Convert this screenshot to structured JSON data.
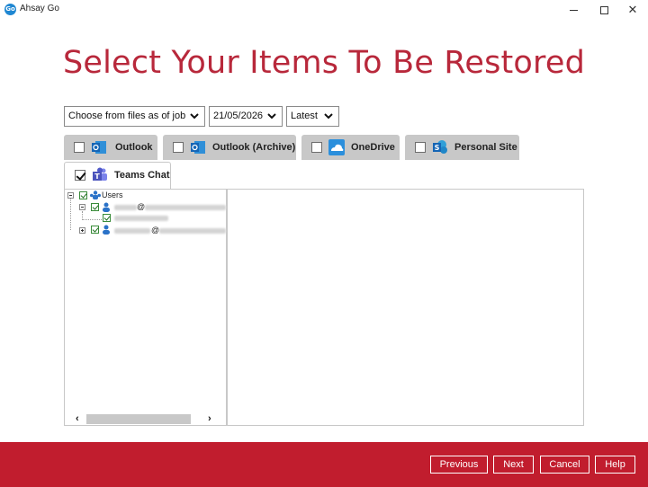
{
  "window": {
    "app_icon_text": "Go",
    "title": "Ahsay Go"
  },
  "page": {
    "heading": "Select Your Items To Be Restored"
  },
  "filters": {
    "mode": "Choose from files as of job",
    "date": "21/05/2026",
    "version": "Latest"
  },
  "tabs": [
    {
      "label": "Outlook",
      "checked": false,
      "icon": "outlook-icon"
    },
    {
      "label": "Outlook (Archive)",
      "checked": false,
      "icon": "outlook-archive-icon"
    },
    {
      "label": "OneDrive",
      "checked": false,
      "icon": "onedrive-icon"
    },
    {
      "label": "Personal Site",
      "checked": false,
      "icon": "sharepoint-icon"
    },
    {
      "label": "Teams Chat",
      "checked": true,
      "active": true,
      "icon": "teams-icon"
    }
  ],
  "tree": {
    "root_label": "Users",
    "user1_domain_sep": "@"
  },
  "footer": {
    "previous": "Previous",
    "next": "Next",
    "cancel": "Cancel",
    "help": "Help"
  },
  "colors": {
    "accent": "#c11d2e",
    "heading": "#b8283b",
    "tab_inactive": "#c8c8c8"
  }
}
